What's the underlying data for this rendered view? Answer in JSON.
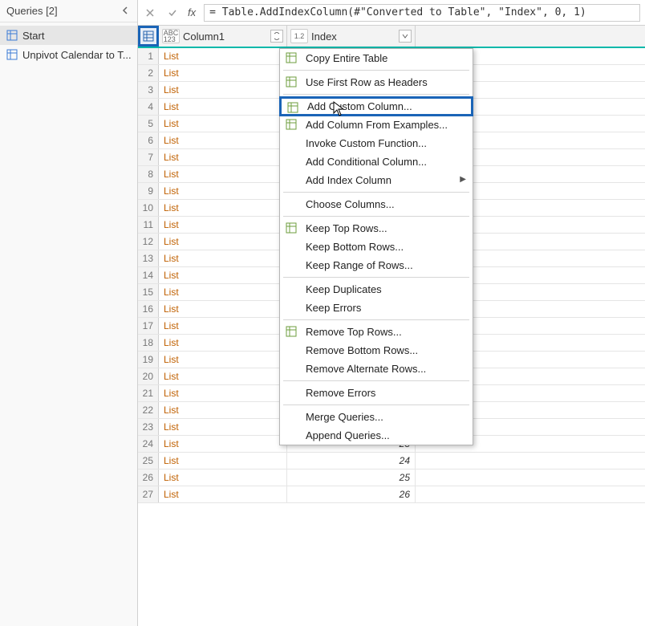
{
  "queries": {
    "header": "Queries [2]",
    "items": [
      "Start",
      "Unpivot Calendar to T..."
    ]
  },
  "formula_bar": {
    "fx": "fx",
    "value": "= Table.AddIndexColumn(#\"Converted to Table\", \"Index\", 0, 1)"
  },
  "columns": {
    "col1": {
      "type": "ABC\n123",
      "label": "Column1",
      "filter": "↕"
    },
    "col2": {
      "type": "1.2",
      "label": "Index"
    }
  },
  "context_menu": {
    "items": [
      {
        "label": "Copy Entire Table",
        "icon": "copy"
      },
      {
        "sep": true
      },
      {
        "label": "Use First Row as Headers",
        "icon": "headers"
      },
      {
        "sep": true
      },
      {
        "label": "Add Custom Column...",
        "icon": "addcol",
        "highlight": true
      },
      {
        "label": "Add Column From Examples...",
        "icon": "examples"
      },
      {
        "label": "Invoke Custom Function..."
      },
      {
        "label": "Add Conditional Column..."
      },
      {
        "label": "Add Index Column",
        "submenu": true
      },
      {
        "sep": true
      },
      {
        "label": "Choose Columns..."
      },
      {
        "sep": true
      },
      {
        "label": "Keep Top Rows...",
        "icon": "keeptop"
      },
      {
        "label": "Keep Bottom Rows..."
      },
      {
        "label": "Keep Range of Rows..."
      },
      {
        "sep": true
      },
      {
        "label": "Keep Duplicates"
      },
      {
        "label": "Keep Errors"
      },
      {
        "sep": true
      },
      {
        "label": "Remove Top Rows...",
        "icon": "removetop"
      },
      {
        "label": "Remove Bottom Rows..."
      },
      {
        "label": "Remove Alternate Rows..."
      },
      {
        "sep": true
      },
      {
        "label": "Remove Errors"
      },
      {
        "sep": true
      },
      {
        "label": "Merge Queries..."
      },
      {
        "label": "Append Queries..."
      }
    ]
  },
  "grid": {
    "column1_value": "List",
    "index_start": 0,
    "rows_total": 27,
    "visible_from_row": 23
  }
}
